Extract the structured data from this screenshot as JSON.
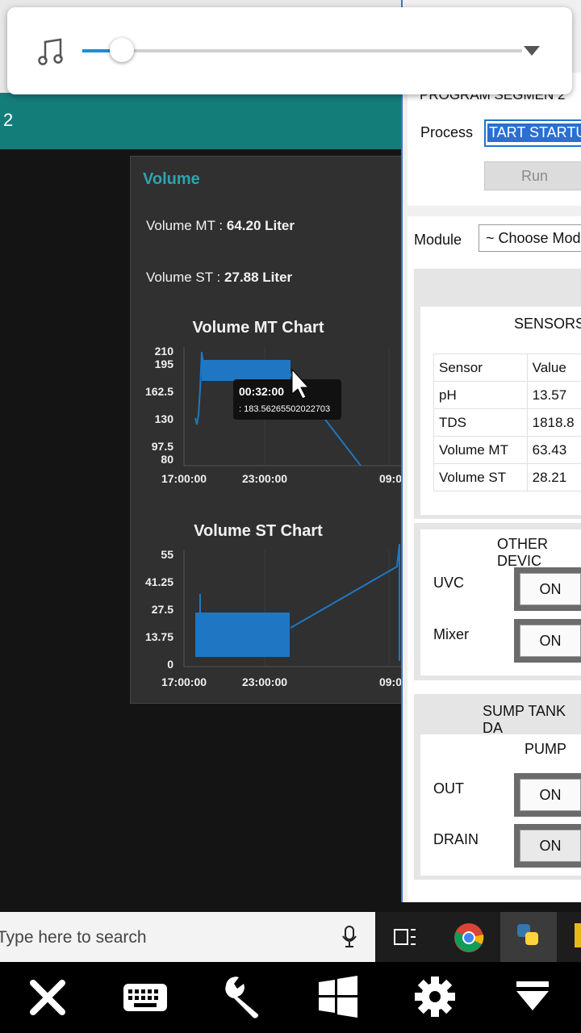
{
  "teal_bar": {
    "number": "2"
  },
  "volume_panel": {
    "title": "Volume",
    "mt_label": "Volume MT :",
    "mt_value": "64.20 Liter",
    "st_label": "Volume ST :",
    "st_value": "27.88 Liter"
  },
  "chart_data": [
    {
      "type": "line",
      "title": "Volume MT Chart",
      "x_ticks": [
        "17:00:00",
        "23:00:00",
        "09:0"
      ],
      "y_ticks": [
        "210",
        "195",
        "162.5",
        "130",
        "97.5",
        "80"
      ],
      "ylim": [
        80,
        210
      ],
      "series_color": "#1f77c4",
      "tooltip": {
        "time": "00:32:00",
        "value": ": 183.56265502022703"
      }
    },
    {
      "type": "line",
      "title": "Volume ST Chart",
      "x_ticks": [
        "17:00:00",
        "23:00:00",
        "09:0"
      ],
      "y_ticks": [
        "55",
        "41.25",
        "27.5",
        "13.75",
        "0"
      ],
      "ylim": [
        0,
        55
      ],
      "series_color": "#1f77c4"
    }
  ],
  "app": {
    "program_title": "PROGRAM SEGMEN 2",
    "process_label": "Process",
    "process_value": "TART STARTUP",
    "run_label": "Run",
    "module_label": "Module",
    "module_value": "~ Choose Mod",
    "sensors_title": "SENSORS",
    "sensor_headers": [
      "Sensor",
      "Value"
    ],
    "sensors": [
      {
        "name": "pH",
        "value": "13.57"
      },
      {
        "name": "TDS",
        "value": "1818.8"
      },
      {
        "name": "Volume MT",
        "value": "63.43"
      },
      {
        "name": "Volume ST",
        "value": "28.21"
      }
    ],
    "other_devices_title": "OTHER DEVIC",
    "uvc_label": "UVC",
    "uvc_state": "ON",
    "mixer_label": "Mixer",
    "mixer_state": "ON",
    "sump_title": "SUMP TANK DA",
    "pump_title": "PUMP",
    "out_label": "OUT",
    "out_state": "ON",
    "drain_label": "DRAIN",
    "drain_state": "ON"
  },
  "taskbar": {
    "search_placeholder": "Type here to search"
  },
  "media": {
    "volume_percent": 9
  }
}
